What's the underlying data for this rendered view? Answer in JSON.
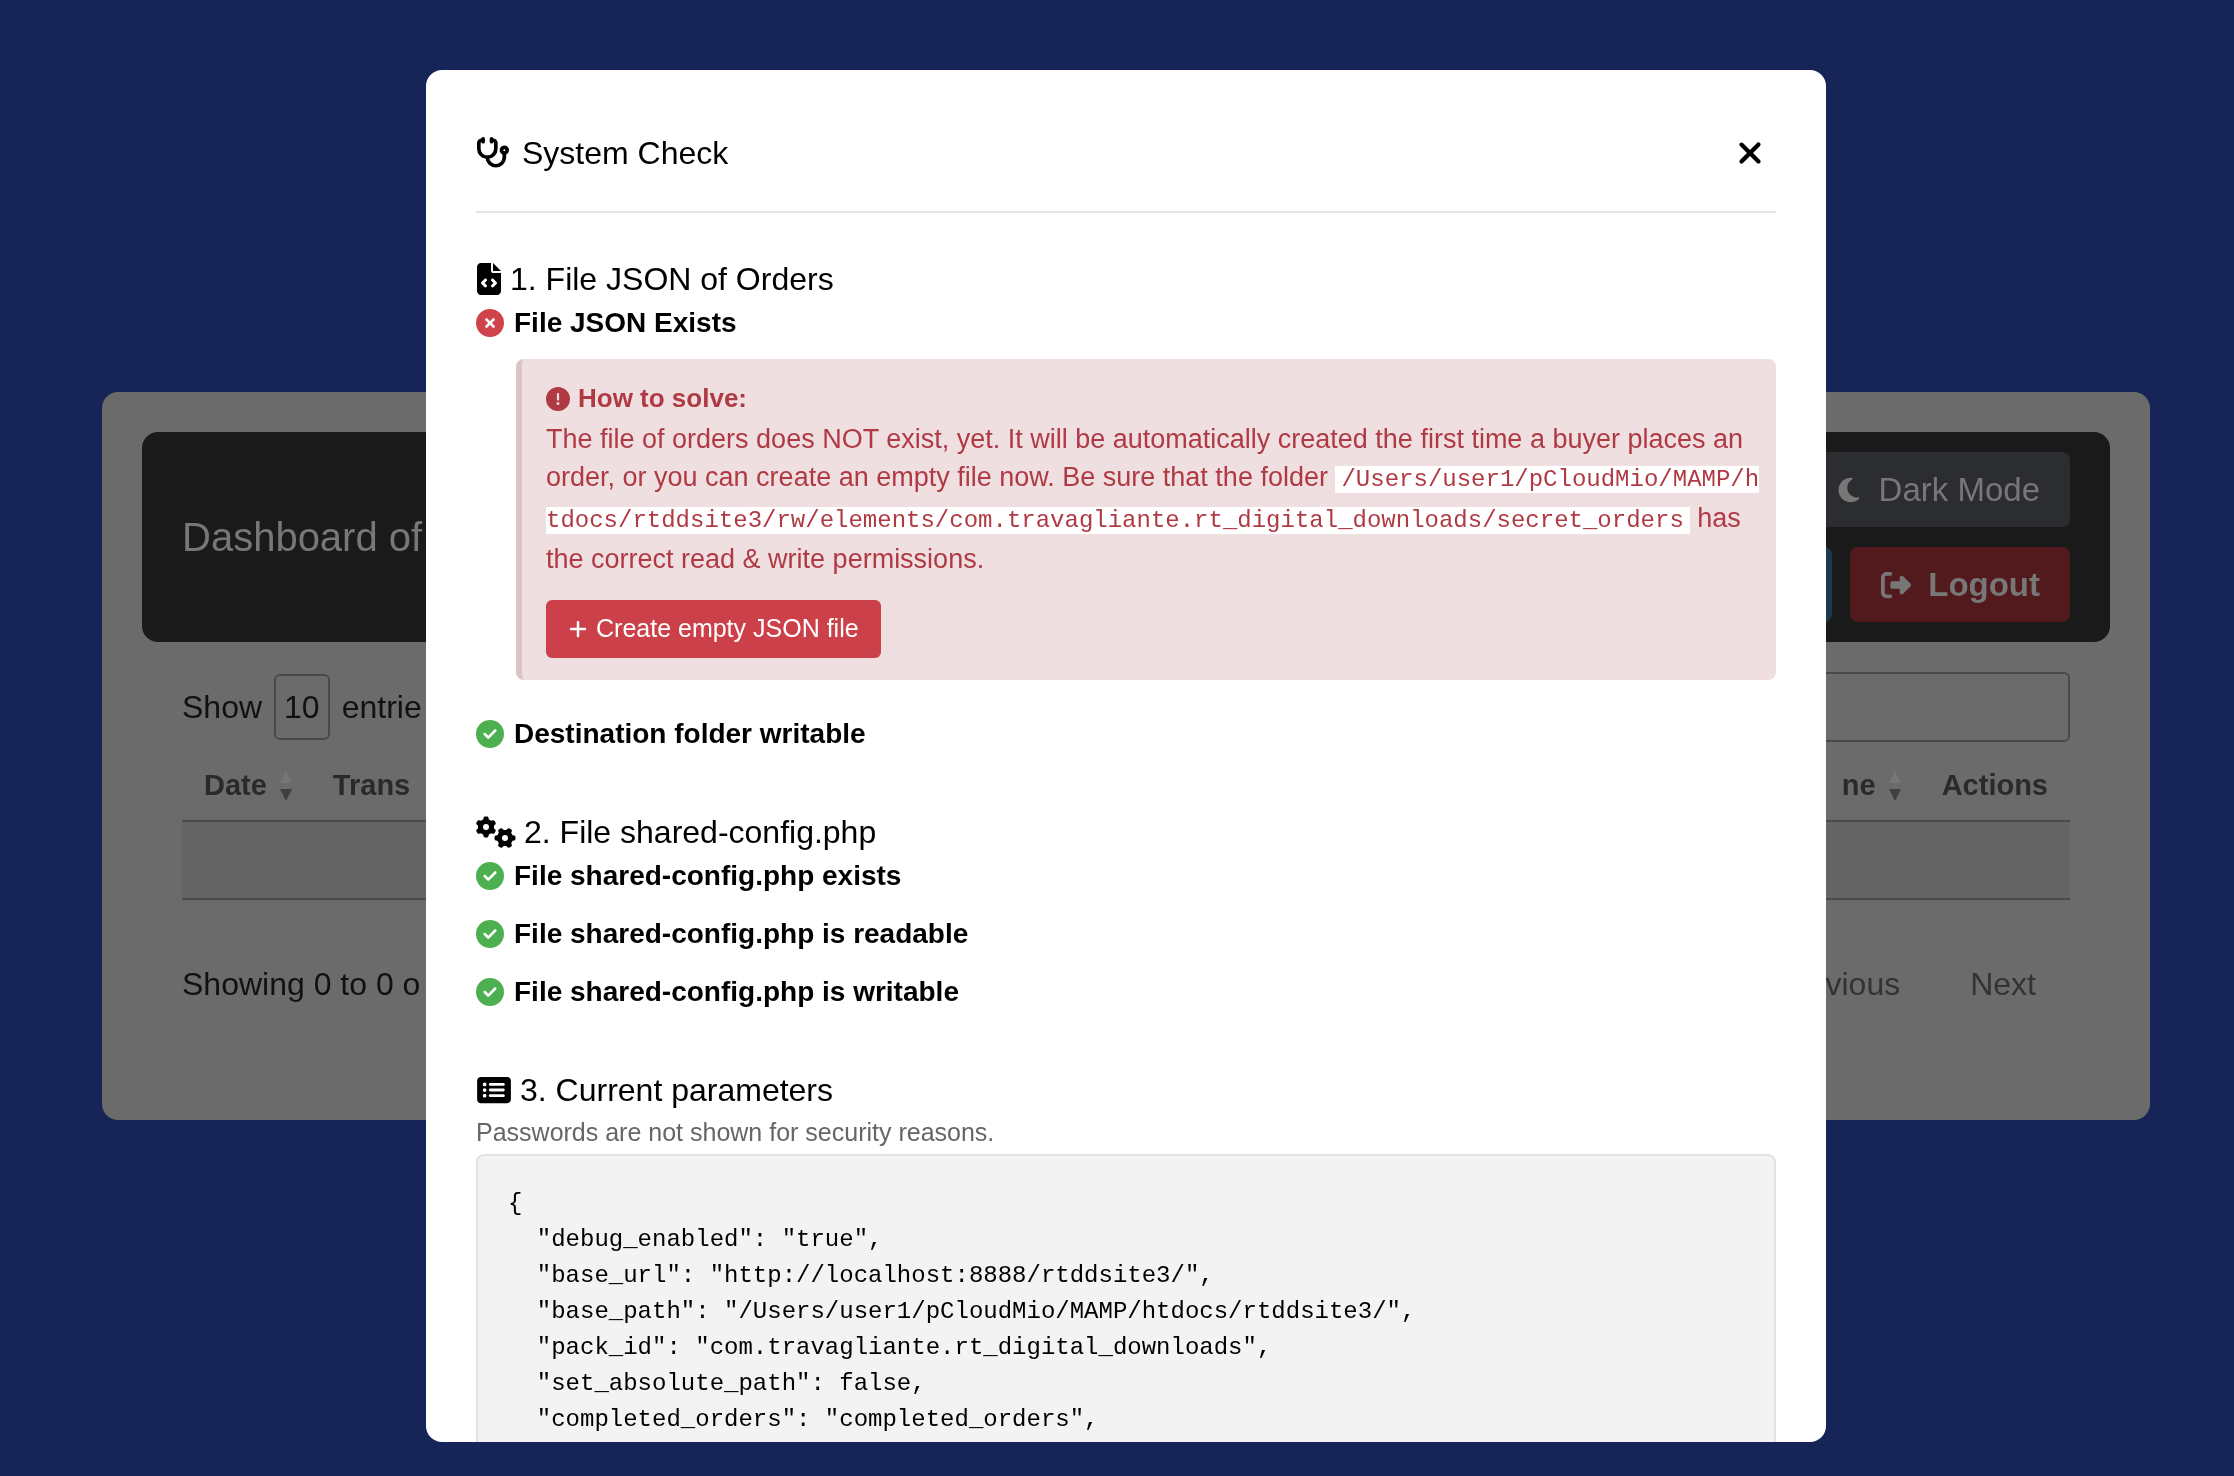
{
  "background": {
    "title": "Dashboard of",
    "dark_mode_button": "Dark Mode",
    "logout_button": "Logout",
    "show_label": "Show",
    "page_length": "10",
    "entries_label": "entrie",
    "columns": [
      {
        "label": "Date",
        "sortable": true
      },
      {
        "label": "Trans",
        "sortable": false
      },
      {
        "label": "ne",
        "sortable": true
      },
      {
        "label": "Actions",
        "sortable": false
      }
    ],
    "info": "Showing 0 to 0 o",
    "previous": "vious",
    "next": "Next"
  },
  "modal": {
    "title": "System Check",
    "sections": [
      {
        "kind": "file",
        "heading": "1. File JSON of Orders",
        "checks": [
          {
            "label": "File JSON Exists",
            "ok": false,
            "help": {
              "title": "How to solve:",
              "text_before": "The file of orders does NOT exist, yet. It will be automatically created the first time a buyer places an order, or you can create an empty file now. Be sure that the folder",
              "path": "/Users/user1/pCloudMio/MAMP/htdocs/rtddsite3/rw/elements/com.travagliante.rt_digital_downloads/secret_orders",
              "text_after": "has the correct read & write permissions.",
              "button": "Create empty JSON file"
            }
          },
          {
            "label": "Destination folder writable",
            "ok": true
          }
        ]
      },
      {
        "kind": "gears",
        "heading": "2. File shared-config.php",
        "checks": [
          {
            "label": "File shared-config.php exists",
            "ok": true
          },
          {
            "label": "File shared-config.php is readable",
            "ok": true
          },
          {
            "label": "File shared-config.php is writable",
            "ok": true
          }
        ]
      },
      {
        "kind": "list",
        "heading": "3. Current parameters",
        "note": "Passwords are not shown for security reasons.",
        "code": [
          "{",
          "  \"debug_enabled\": \"true\",",
          "  \"base_url\": \"http://localhost:8888/rtddsite3/\",",
          "  \"base_path\": \"/Users/user1/pCloudMio/MAMP/htdocs/rtddsite3/\",",
          "  \"pack_id\": \"com.travagliante.rt_digital_downloads\",",
          "  \"set_absolute_path\": false,",
          "  \"completed_orders\": \"completed_orders\","
        ]
      }
    ]
  }
}
